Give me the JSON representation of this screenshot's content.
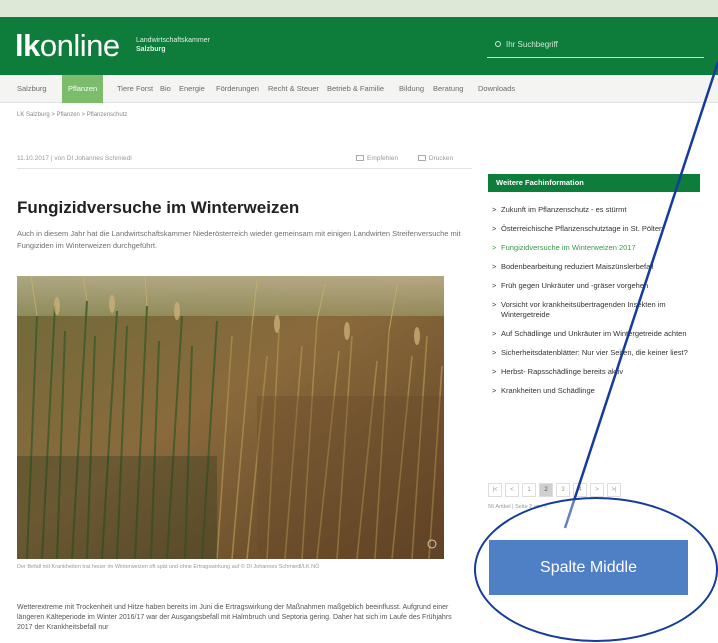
{
  "header": {
    "logo_bold": "lk",
    "logo_rest": "online",
    "logo_sub_1": "Landwirtschaftskammer",
    "logo_sub_2": "Salzburg",
    "search_placeholder": "Ihr Suchbegriff"
  },
  "nav": {
    "items": [
      "Salzburg",
      "Pflanzen",
      "Tiere",
      "Forst",
      "Bio",
      "Energie",
      "Förderungen",
      "Recht & Steuer",
      "Betrieb & Familie",
      "Bildung",
      "Beratung",
      "Downloads"
    ],
    "active": "Pflanzen"
  },
  "breadcrumb": "LK Salzburg  >  Pflanzen  >  Pflanzenschutz",
  "article": {
    "meta": "11.10.2017 | von DI Johannes Schmiedl",
    "share_label": "Empfehlen",
    "print_label": "Drucken",
    "title": "Fungizidversuche im Winterweizen",
    "lead": "Auch in diesem Jahr hat die Landwirtschaftskammer Niederösterreich wieder gemeinsam mit einigen Landwirten Streifenversuche mit Fungiziden im Winterweizen durchgeführt.",
    "caption": "Der Befall mit Krankheiten trat heuer im Winterweizen oft spät und ohne Ertragswirkung auf © DI Johannes Schmiedl/LK NÖ",
    "body": "Wetterextreme mit Trockenheit und Hitze haben bereits im Juni die Ertragswirkung der Maßnahmen maßgeblich beeinflusst. Aufgrund einer längeren Kälteperiode im Winter 2016/17 war der Ausgangsbefall mit Halmbruch und Septoria gering. Daher hat sich im Laufe des Frühjahrs 2017 der Krankheitsbefall nur"
  },
  "sidebar": {
    "title": "Weitere Fachinformation",
    "items": [
      "Zukunft im Pflanzenschutz - es stürmt",
      "Österreichische Pflanzenschutztage in St. Pölten",
      "Fungizidversuche im Winterweizen 2017",
      "Bodenbearbeitung reduziert Maiszünslerbefall",
      "Früh gegen Unkräuter und -gräser vorgehen",
      "Vorsicht vor krankheitsübertragenden Insekten im Wintergetreide",
      "Auf Schädlinge und Unkräuter im Wintergetreide achten",
      "Sicherheitsdatenblätter: Nur vier Seiten, die keiner liest?",
      "Herbst- Rapsschädlinge bereits aktiv",
      "Krankheiten und Schädlinge"
    ],
    "highlight_index": 2,
    "pager": [
      "|<",
      "<",
      "1",
      "2",
      "3",
      "4",
      ">",
      ">|"
    ],
    "pager_active": "2",
    "pager_info": "56 Artikel | Seite 2 von 6"
  },
  "annotation": {
    "label": "Spalte Middle",
    "color": "#153c9a",
    "box_color": "#4f7fc4"
  },
  "colors": {
    "brand_green": "#0e7c3a",
    "nav_active": "#7bbd6a"
  }
}
